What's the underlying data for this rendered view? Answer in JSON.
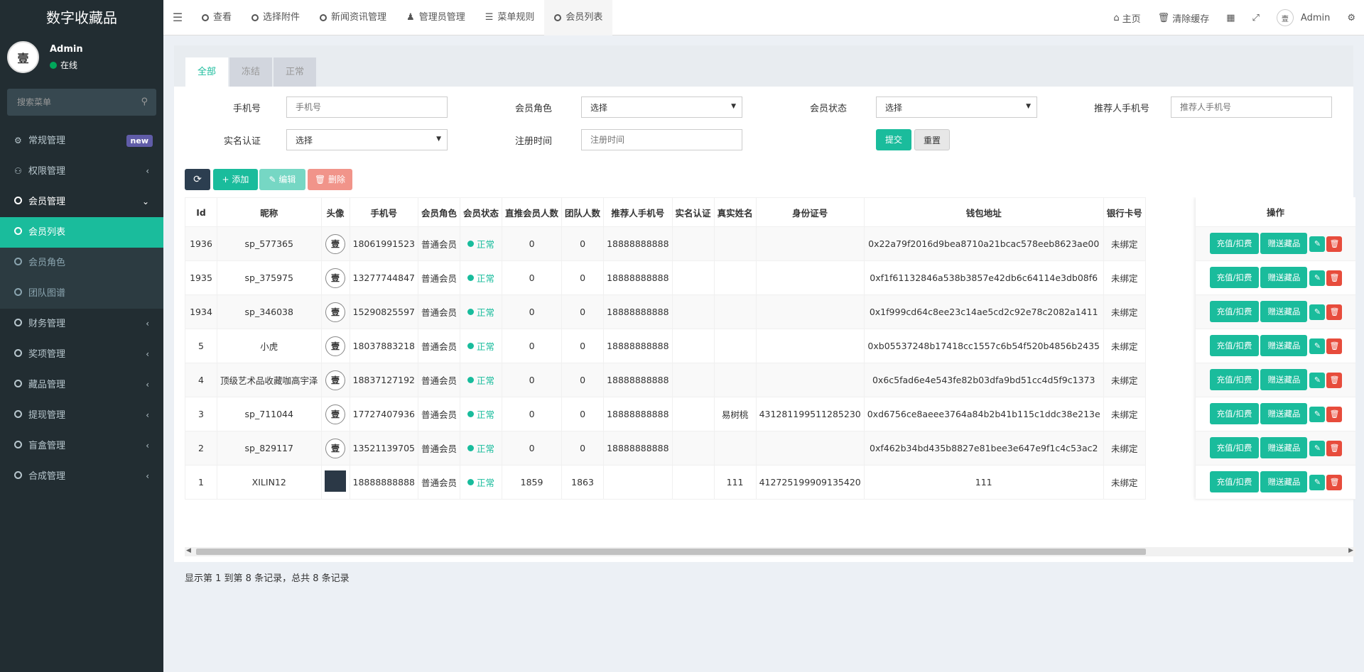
{
  "sidebar": {
    "brand": "数字收藏品",
    "user": {
      "name": "Admin",
      "status": "在线",
      "avatar_text": "壹"
    },
    "search_placeholder": "搜索菜单",
    "menu": [
      {
        "label": "常规管理",
        "icon": "cogs-icon",
        "badge": "new"
      },
      {
        "label": "权限管理",
        "icon": "users-icon"
      },
      {
        "label": "会员管理",
        "icon": "circle-icon"
      }
    ],
    "sub_menu": [
      {
        "label": "会员列表"
      },
      {
        "label": "会员角色"
      },
      {
        "label": "团队图谱"
      }
    ],
    "menu2": [
      {
        "label": "财务管理"
      },
      {
        "label": "奖项管理"
      },
      {
        "label": "藏品管理"
      },
      {
        "label": "提现管理"
      },
      {
        "label": "盲盒管理"
      },
      {
        "label": "合成管理"
      }
    ]
  },
  "topbar": {
    "tabs": [
      "查看",
      "选择附件",
      "新闻资讯管理",
      "管理员管理",
      "菜单规则",
      "会员列表"
    ],
    "right": {
      "home": "主页",
      "clear_cache": "清除缓存",
      "admin": "Admin"
    }
  },
  "filter_tabs": [
    "全部",
    "冻结",
    "正常"
  ],
  "filters": {
    "phone": {
      "label": "手机号",
      "placeholder": "手机号"
    },
    "role": {
      "label": "会员角色",
      "value": "选择"
    },
    "status": {
      "label": "会员状态",
      "value": "选择"
    },
    "ref_phone": {
      "label": "推荐人手机号",
      "placeholder": "推荐人手机号"
    },
    "realname": {
      "label": "实名认证",
      "value": "选择"
    },
    "reg_time": {
      "label": "注册时间",
      "placeholder": "注册时间"
    },
    "submit": "提交",
    "reset": "重置"
  },
  "toolbar": {
    "add": "添加",
    "edit": "编辑",
    "delete": "删除"
  },
  "table": {
    "headers": [
      "Id",
      "昵称",
      "头像",
      "手机号",
      "会员角色",
      "会员状态",
      "直推会员人数",
      "团队人数",
      "推荐人手机号",
      "实名认证",
      "真实姓名",
      "身份证号",
      "钱包地址",
      "银行卡号"
    ],
    "ops_header": "操作",
    "ops_buttons": {
      "recharge": "充值/扣费",
      "gift": "赠送藏品"
    },
    "rows": [
      {
        "id": "1936",
        "nick": "sp_577365",
        "phone": "18061991523",
        "role": "普通会员",
        "status": "正常",
        "direct": "0",
        "team": "0",
        "ref": "18888888888",
        "real": "",
        "name": "",
        "idno": "",
        "wallet": "0x22a79f2016d9bea8710a21bcac578eeb8623ae00",
        "bank": "未绑定"
      },
      {
        "id": "1935",
        "nick": "sp_375975",
        "phone": "13277744847",
        "role": "普通会员",
        "status": "正常",
        "direct": "0",
        "team": "0",
        "ref": "18888888888",
        "real": "",
        "name": "",
        "idno": "",
        "wallet": "0xf1f61132846a538b3857e42db6c64114e3db08f6",
        "bank": "未绑定"
      },
      {
        "id": "1934",
        "nick": "sp_346038",
        "phone": "15290825597",
        "role": "普通会员",
        "status": "正常",
        "direct": "0",
        "team": "0",
        "ref": "18888888888",
        "real": "",
        "name": "",
        "idno": "",
        "wallet": "0x1f999cd64c8ee23c14ae5cd2c92e78c2082a1411",
        "bank": "未绑定"
      },
      {
        "id": "5",
        "nick": "小虎",
        "phone": "18037883218",
        "role": "普通会员",
        "status": "正常",
        "direct": "0",
        "team": "0",
        "ref": "18888888888",
        "real": "",
        "name": "",
        "idno": "",
        "wallet": "0xb05537248b17418cc1557c6b54f520b4856b2435",
        "bank": "未绑定"
      },
      {
        "id": "4",
        "nick": "顶级艺术品收藏咖高宇泽",
        "phone": "18837127192",
        "role": "普通会员",
        "status": "正常",
        "direct": "0",
        "team": "0",
        "ref": "18888888888",
        "real": "",
        "name": "",
        "idno": "",
        "wallet": "0x6c5fad6e4e543fe82b03dfa9bd51cc4d5f9c1373",
        "bank": "未绑定"
      },
      {
        "id": "3",
        "nick": "sp_711044",
        "phone": "17727407936",
        "role": "普通会员",
        "status": "正常",
        "direct": "0",
        "team": "0",
        "ref": "18888888888",
        "real": "",
        "name": "易树桃",
        "idno": "431281199511285230",
        "wallet": "0xd6756ce8aeee3764a84b2b41b115c1ddc38e213e",
        "bank": "未绑定"
      },
      {
        "id": "2",
        "nick": "sp_829117",
        "phone": "13521139705",
        "role": "普通会员",
        "status": "正常",
        "direct": "0",
        "team": "0",
        "ref": "18888888888",
        "real": "",
        "name": "",
        "idno": "",
        "wallet": "0xf462b34bd435b8827e81bee3e647e9f1c4c53ac2",
        "bank": "未绑定"
      },
      {
        "id": "1",
        "nick": "XILIN12",
        "phone": "18888888888",
        "role": "普通会员",
        "status": "正常",
        "direct": "1859",
        "team": "1863",
        "ref": "",
        "real": "",
        "name": "111",
        "idno": "412725199909135420",
        "wallet": "111",
        "bank": "未绑定"
      }
    ]
  },
  "pager_info": "显示第 1 到第 8 条记录，总共 8 条记录"
}
